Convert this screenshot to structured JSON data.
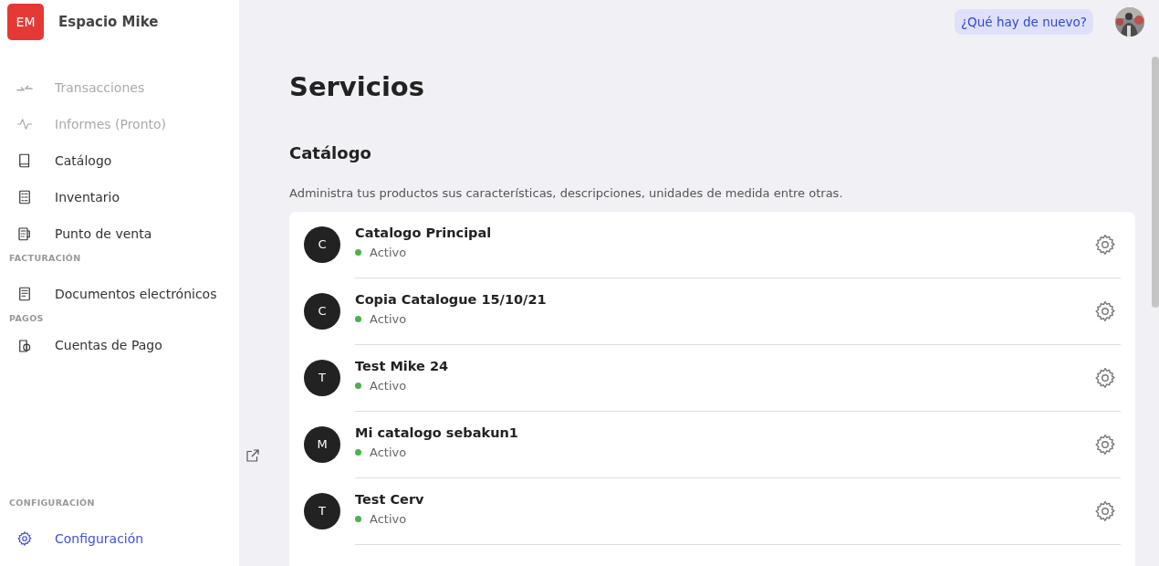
{
  "workspace": {
    "initials": "EM",
    "name": "Espacio Mike"
  },
  "nav_sections": [
    {
      "items": [
        {
          "label": "Transacciones",
          "disabled": true,
          "selected": false
        },
        {
          "label": "Informes (Pronto)",
          "disabled": true,
          "selected": false
        },
        {
          "label": "Catálogo",
          "disabled": false,
          "selected": false
        },
        {
          "label": "Inventario",
          "disabled": false,
          "selected": false
        },
        {
          "label": "Punto de venta",
          "disabled": false,
          "selected": false
        }
      ]
    },
    {
      "heading": "FACTURACIÓN",
      "items": [
        {
          "label": "Documentos electrónicos",
          "disabled": false,
          "selected": false
        }
      ]
    },
    {
      "heading": "PAGOS",
      "items": [
        {
          "label": "Cuentas de Pago",
          "disabled": false,
          "selected": false
        }
      ]
    },
    {
      "heading": "CONFIGURACIÓN",
      "items": [
        {
          "label": "Configuración",
          "disabled": false,
          "selected": true
        }
      ]
    }
  ],
  "whats_new": "¿Qué hay de nuevo?",
  "page_title": "Servicios",
  "section": {
    "title": "Catálogo",
    "description": "Administra tus productos sus características, descripciones, unidades de medida entre otras."
  },
  "catalogs": [
    {
      "initial": "C",
      "name": "Catalogo Principal",
      "status": "Activo"
    },
    {
      "initial": "C",
      "name": "Copia Catalogue 15/10/21",
      "status": "Activo"
    },
    {
      "initial": "T",
      "name": "Test Mike 24",
      "status": "Activo"
    },
    {
      "initial": "M",
      "name": "Mi catalogo sebakun1",
      "status": "Activo"
    },
    {
      "initial": "T",
      "name": "Test Cerv",
      "status": "Activo"
    }
  ]
}
